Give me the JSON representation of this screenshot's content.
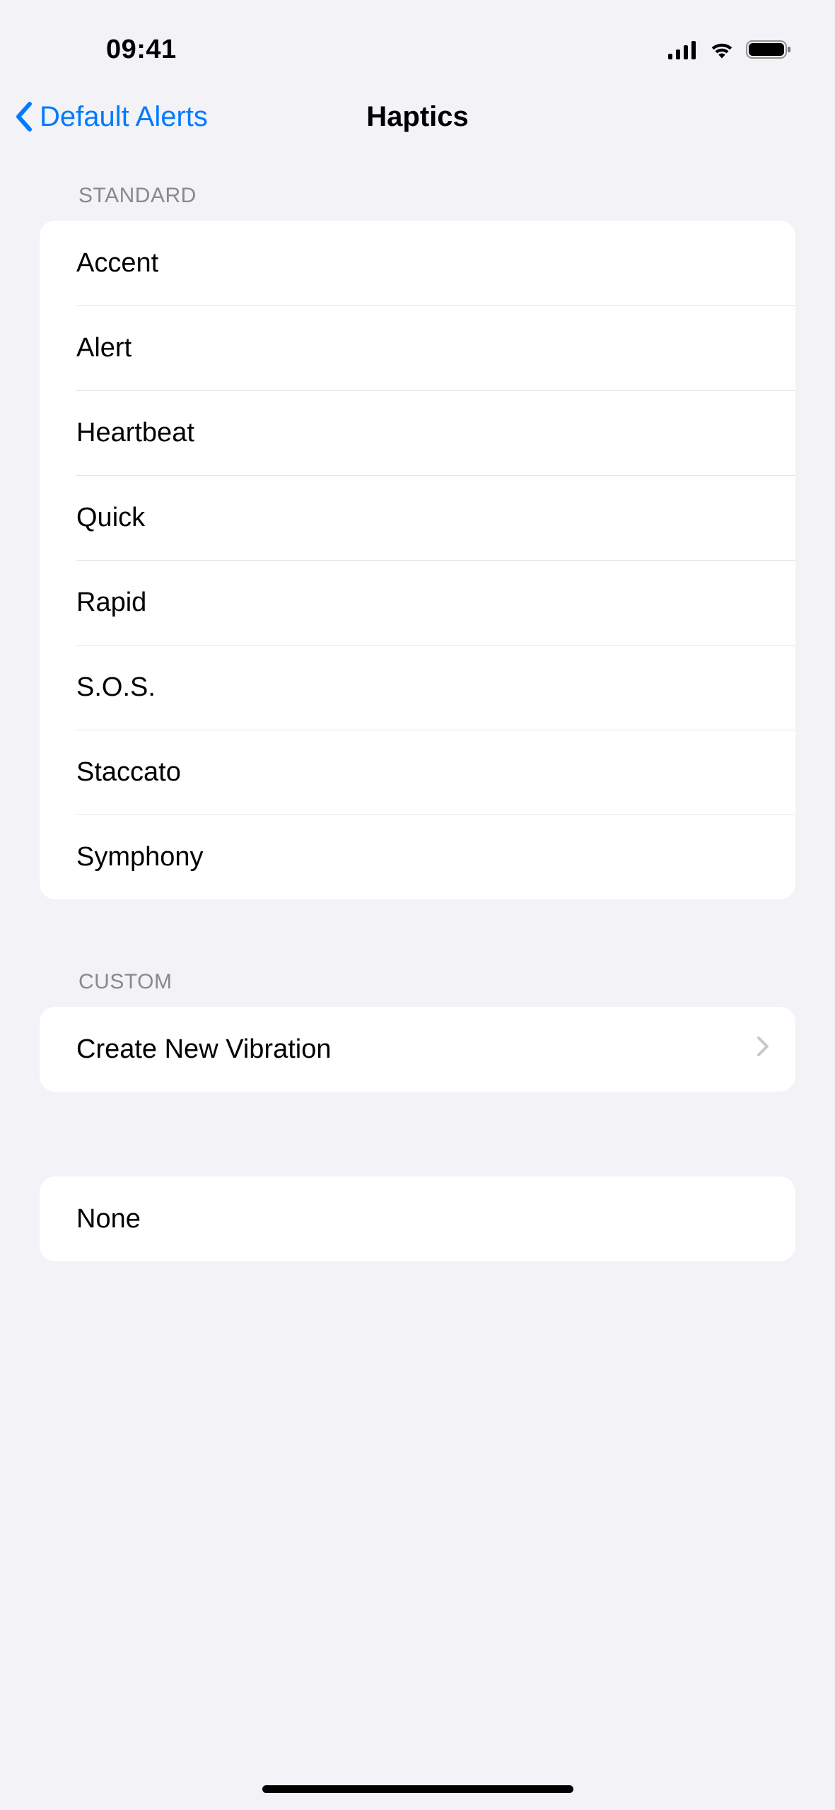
{
  "status": {
    "time": "09:41"
  },
  "nav": {
    "back_label": "Default Alerts",
    "title": "Haptics"
  },
  "sections": {
    "standard": {
      "header": "Standard",
      "items": [
        "Accent",
        "Alert",
        "Heartbeat",
        "Quick",
        "Rapid",
        "S.O.S.",
        "Staccato",
        "Symphony"
      ]
    },
    "custom": {
      "header": "Custom",
      "create_label": "Create New Vibration"
    },
    "none": {
      "label": "None"
    }
  },
  "icons": {
    "cellular": "cellular-icon",
    "wifi": "wifi-icon",
    "battery": "battery-icon",
    "back": "chevron-left-icon",
    "disclosure": "chevron-right-icon"
  }
}
